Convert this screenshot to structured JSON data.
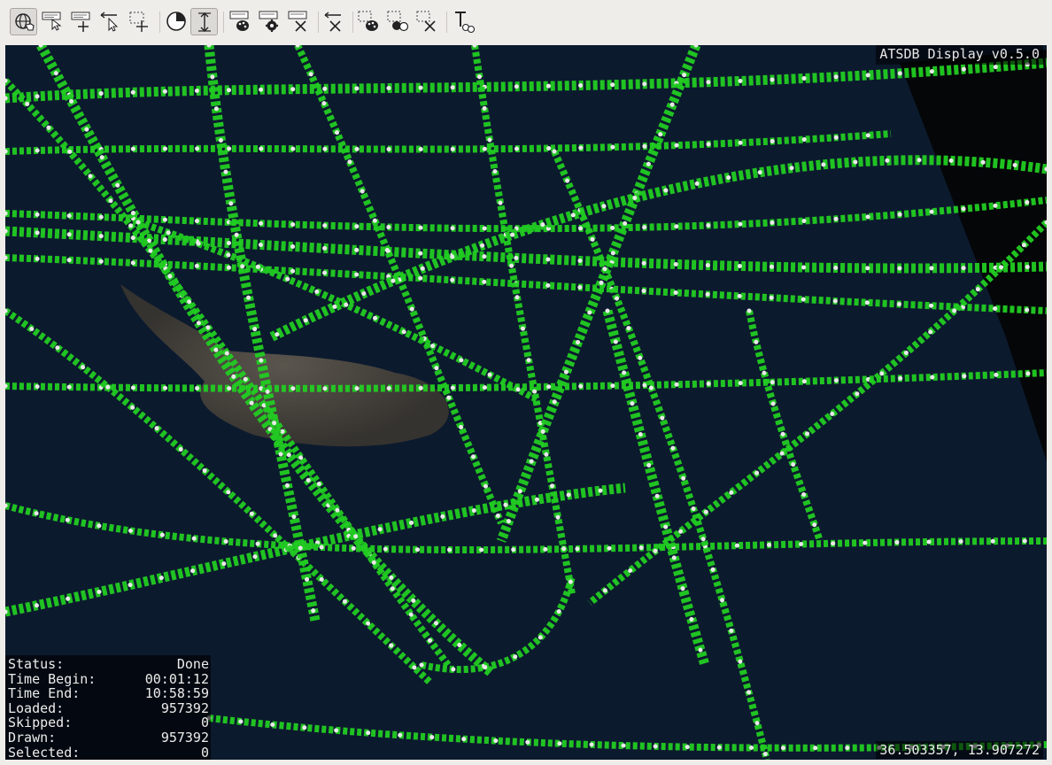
{
  "toolbar": {
    "buttons": [
      {
        "id": "navigate",
        "icon": "globe-hand-icon",
        "active": true
      },
      {
        "id": "select-point",
        "icon": "select-point-icon",
        "active": false
      },
      {
        "id": "add-point",
        "icon": "add-point-icon",
        "active": false
      },
      {
        "id": "select-arrow",
        "icon": "arrow-cursor-icon",
        "active": false
      },
      {
        "id": "select-rect",
        "icon": "rect-select-icon",
        "active": false
      },
      {
        "id": "clock",
        "icon": "clock-icon",
        "active": false
      },
      {
        "id": "height",
        "icon": "height-scale-icon",
        "active": true
      },
      {
        "id": "style-palette",
        "icon": "palette-icon",
        "active": false
      },
      {
        "id": "style-settings",
        "icon": "gear-icon",
        "active": false
      },
      {
        "id": "style-clear",
        "icon": "clear-icon",
        "active": false
      },
      {
        "id": "deselect",
        "icon": "deselect-icon",
        "active": false
      },
      {
        "id": "sel-palette",
        "icon": "selection-palette-icon",
        "active": false
      },
      {
        "id": "sel-settings",
        "icon": "selection-settings-icon",
        "active": false
      },
      {
        "id": "sel-clear",
        "icon": "selection-clear-icon",
        "active": false
      },
      {
        "id": "label",
        "icon": "label-tool-icon",
        "active": false
      }
    ]
  },
  "viewport": {
    "version": "ATSDB Display v0.5.0",
    "coords": "36.503357, 13.907272",
    "colors": {
      "track": "#22cc22",
      "point": "#e8e8e8",
      "sea": "#0c1a2e",
      "land": "#4a463f"
    }
  },
  "status": {
    "rows": [
      {
        "label": "Status:",
        "value": "Done"
      },
      {
        "label": "Time Begin:",
        "value": "00:01:12"
      },
      {
        "label": "Time End:",
        "value": "10:58:59"
      },
      {
        "label": "Loaded:",
        "value": "957392"
      },
      {
        "label": "Skipped:",
        "value": "0"
      },
      {
        "label": "Drawn:",
        "value": "957392"
      },
      {
        "label": "Selected:",
        "value": "0"
      }
    ]
  }
}
